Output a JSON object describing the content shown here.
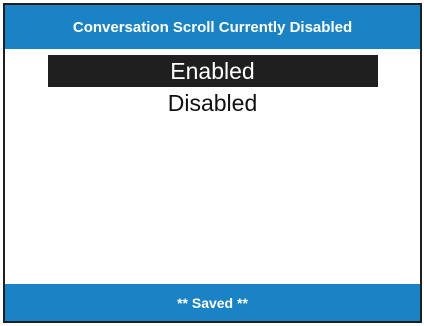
{
  "header": {
    "title": "Conversation Scroll Currently Disabled"
  },
  "menu": {
    "options": [
      {
        "label": "Enabled",
        "selected": true
      },
      {
        "label": "Disabled",
        "selected": false
      }
    ]
  },
  "footer": {
    "status": "** Saved **"
  },
  "colors": {
    "bar": "#1a83c5",
    "highlight": "#1f1f1f",
    "text": "#111111"
  }
}
